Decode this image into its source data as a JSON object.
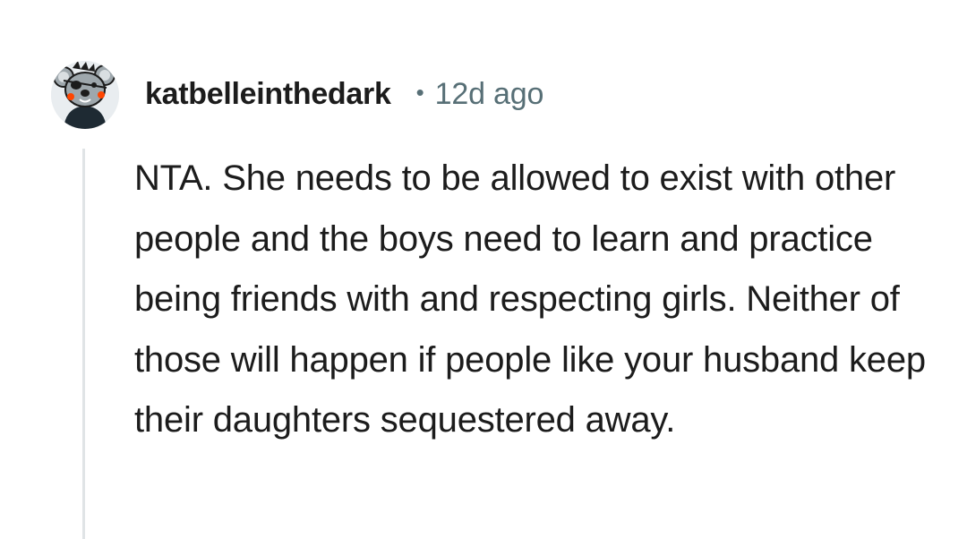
{
  "comment": {
    "author": "katbelleinthedark",
    "separator": "•",
    "timestamp": "12d ago",
    "avatar": {
      "icon": "koala-avatar-icon",
      "colors": {
        "face": "#9ea7ac",
        "ear_inner": "#d9dee1",
        "shirt": "#1e2a33",
        "cheeks": "#ff4500",
        "eyepatch": "#1c1c1c"
      }
    },
    "body": "NTA. She needs to be allowed to exist with other people and the boys need to learn and practice being friends with and respecting girls. Neither of those will happen if people like your husband keep their daughters sequestered away."
  },
  "colors": {
    "text": "#1c1c1c",
    "meta": "#576f76",
    "thread_line": "#e0e4e6",
    "background": "#ffffff"
  }
}
